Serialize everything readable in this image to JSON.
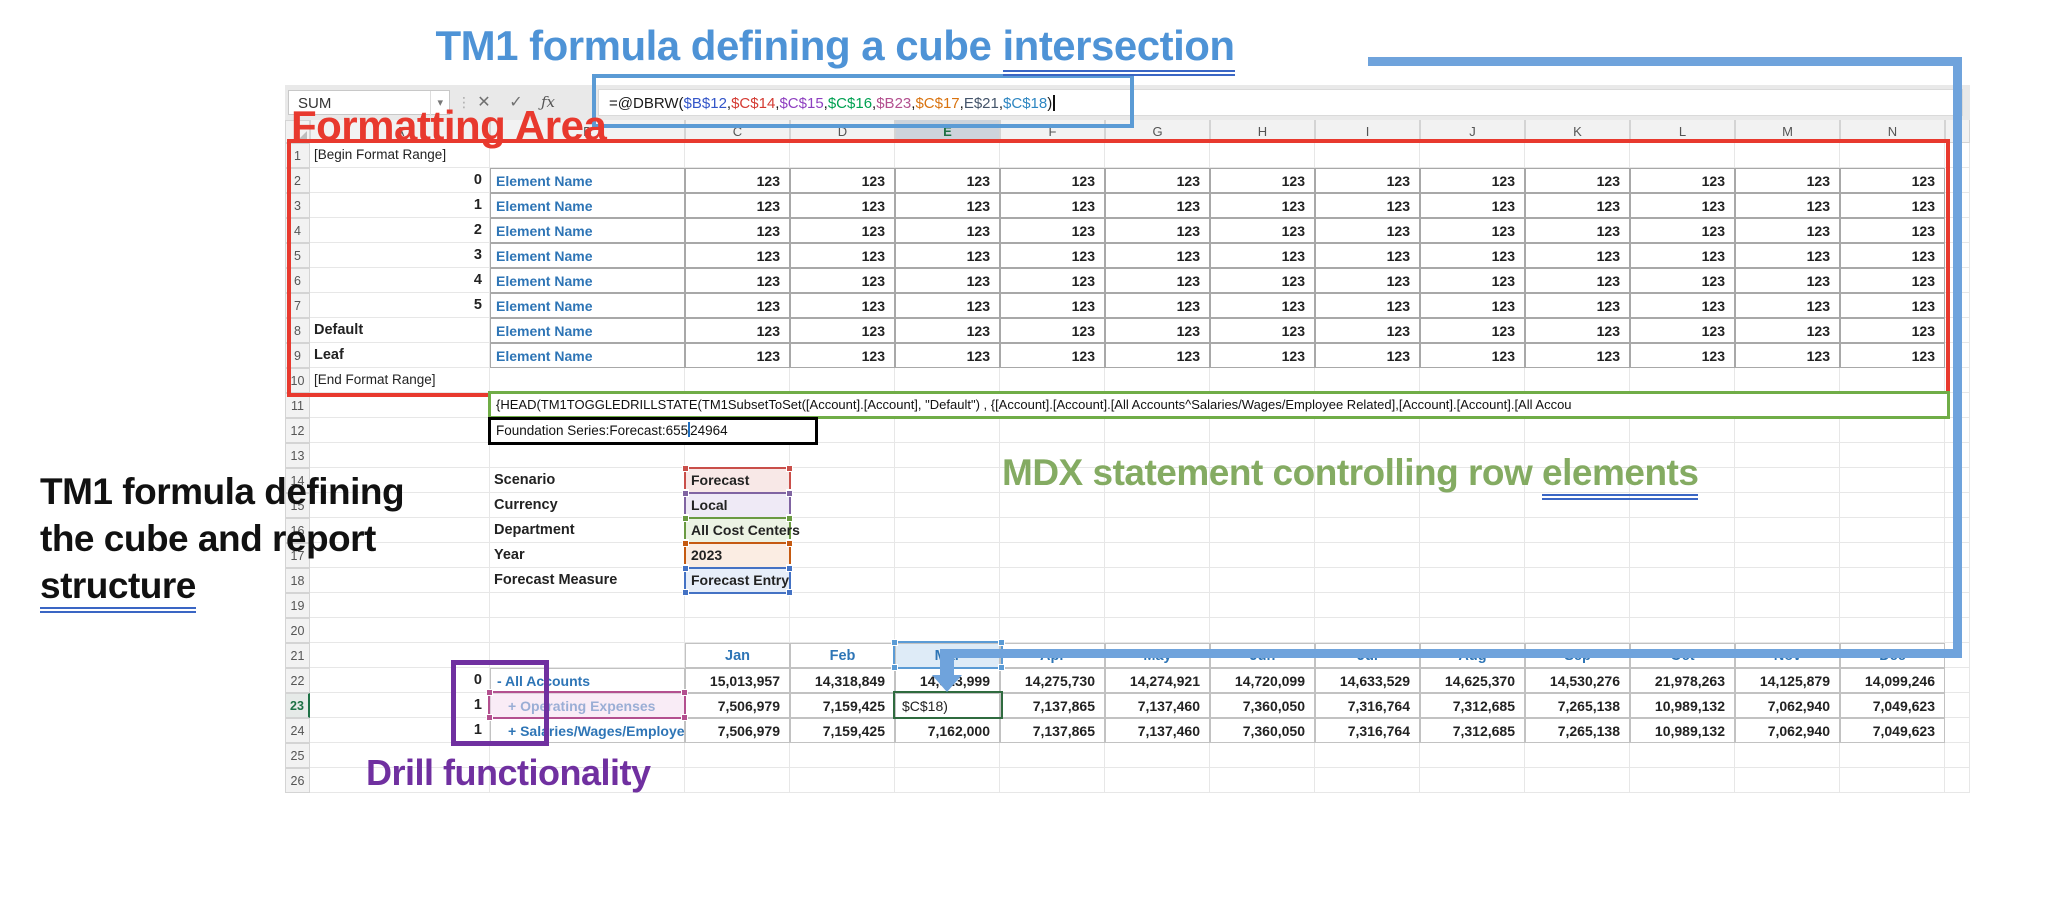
{
  "colors": {
    "accent_blue": "#4E93D6",
    "connector_blue": "#6FA3DC",
    "annotation_red": "#E8392E",
    "annotation_green": "#84AB62",
    "annotation_purple": "#7030A0",
    "underline_blue": "#3A66C4",
    "excel_text_blue": "#2E75B6",
    "mdx_box_green": "#70AD47",
    "drill_range_pink": "#B3508F",
    "mar_selection_blue": "#5B9BD5",
    "edit_cell_green": "#2F6B3F"
  },
  "annotations": {
    "title": {
      "text": "TM1 formula defining a cube ",
      "underlined": "intersection"
    },
    "formatting_area_label": "Formatting Area",
    "cube_structure_label": {
      "line1": "TM1 formula defining",
      "line2": "the cube and report",
      "line3_underlined": "structure"
    },
    "mdx_label": {
      "text": "MDX statement controlling row ",
      "underlined": "elements"
    },
    "drill_label": "Drill functionality"
  },
  "formula_bar": {
    "name_box": "SUM",
    "dropdown_icon": "▾",
    "separator_icon": "⋮",
    "cancel_icon": "✕",
    "enter_icon": "✓",
    "fx_icon": "ƒx",
    "formula_parts": [
      {
        "text": "=@DBRW(",
        "color": "#1a1a1a"
      },
      {
        "text": "$B$12",
        "color": "#3355C8"
      },
      {
        "text": ",",
        "color": "#1a1a1a"
      },
      {
        "text": "$C$14",
        "color": "#D43A32"
      },
      {
        "text": ",",
        "color": "#1a1a1a"
      },
      {
        "text": "$C$15",
        "color": "#8E3FC0"
      },
      {
        "text": ",",
        "color": "#1a1a1a"
      },
      {
        "text": "$C$16",
        "color": "#00A152"
      },
      {
        "text": ",",
        "color": "#1a1a1a"
      },
      {
        "text": "$B23",
        "color": "#B3508F"
      },
      {
        "text": ",",
        "color": "#1a1a1a"
      },
      {
        "text": "$C$17",
        "color": "#D9730F"
      },
      {
        "text": ",",
        "color": "#1a1a1a"
      },
      {
        "text": "E$21",
        "color": "#44546A"
      },
      {
        "text": ",",
        "color": "#1a1a1a"
      },
      {
        "text": "$C$18",
        "color": "#2E86C1"
      },
      {
        "text": ")",
        "color": "#1a1a1a"
      }
    ]
  },
  "sheet": {
    "column_letters": [
      "A",
      "B",
      "C",
      "D",
      "E",
      "F",
      "G",
      "H",
      "I",
      "J",
      "K",
      "L",
      "M",
      "N",
      "O"
    ],
    "selected_column": "E",
    "selected_row": 23,
    "format_area": {
      "begin_label": "[Begin Format Range]",
      "end_label": "[End Format Range]",
      "value_placeholder": "123",
      "rows": [
        {
          "a": "0",
          "b": "Element Name"
        },
        {
          "a": "1",
          "b": "Element Name"
        },
        {
          "a": "2",
          "b": "Element Name"
        },
        {
          "a": "3",
          "b": "Element Name"
        },
        {
          "a": "4",
          "b": "Element Name"
        },
        {
          "a": "5",
          "b": "Element Name"
        },
        {
          "a": "Default",
          "b": "Element Name"
        },
        {
          "a": "Leaf",
          "b": "Element Name"
        }
      ]
    },
    "mdx_row": {
      "text": "{HEAD(TM1TOGGLEDRILLSTATE(TM1SubsetToSet([Account].[Account], \"Default\") , {[Account].[Account].[All Accounts^Salaries/Wages/Employee Related],[Account].[Account].[All Accou"
    },
    "dbr_row": {
      "before_caret": "Foundation Series:Forecast:655",
      "after_caret": "24964"
    },
    "params": [
      {
        "label": "Scenario",
        "value": "Forecast",
        "color": "#C94F4A",
        "fill": "#F8E8E7"
      },
      {
        "label": "Currency",
        "value": "Local",
        "color": "#8064A2",
        "fill": "#EFEAF6"
      },
      {
        "label": "Department",
        "value": "All Cost Centers",
        "color": "#6A9A41",
        "fill": "#ECF3E4"
      },
      {
        "label": "Year",
        "value": "2023",
        "color": "#C55A11",
        "fill": "#FBEDE3"
      },
      {
        "label": "Forecast Measure",
        "value": "Forecast Entry",
        "color": "#4472C4",
        "fill": "#E7EEF9"
      }
    ],
    "months": [
      "Jan",
      "Feb",
      "Mar",
      "Apr",
      "May",
      "Jun",
      "Jul",
      "Aug",
      "Sep",
      "Oct",
      "Nov",
      "Dec"
    ],
    "selected_month": "Mar",
    "data_rows": [
      {
        "a": "0",
        "name": "- All Accounts",
        "indent": false,
        "values": [
          "15,013,957",
          "14,318,849",
          "14,323,999",
          "14,275,730",
          "14,274,921",
          "14,720,099",
          "14,633,529",
          "14,625,370",
          "14,530,276",
          "21,978,263",
          "14,125,879",
          "14,099,246"
        ]
      },
      {
        "a": "1",
        "name": "+ Operating Expenses",
        "indent": true,
        "editing_cell": "Mar",
        "edit_text": "$C$18)",
        "values": [
          "7,506,979",
          "7,159,425",
          "$C$18)",
          "7,137,865",
          "7,137,460",
          "7,360,050",
          "7,316,764",
          "7,312,685",
          "7,265,138",
          "10,989,132",
          "7,062,940",
          "7,049,623"
        ]
      },
      {
        "a": "1",
        "name": "+ Salaries/Wages/Employee",
        "indent": true,
        "values": [
          "7,506,979",
          "7,159,425",
          "7,162,000",
          "7,137,865",
          "7,137,460",
          "7,360,050",
          "7,316,764",
          "7,312,685",
          "7,265,138",
          "10,989,132",
          "7,062,940",
          "7,049,623"
        ]
      }
    ]
  }
}
